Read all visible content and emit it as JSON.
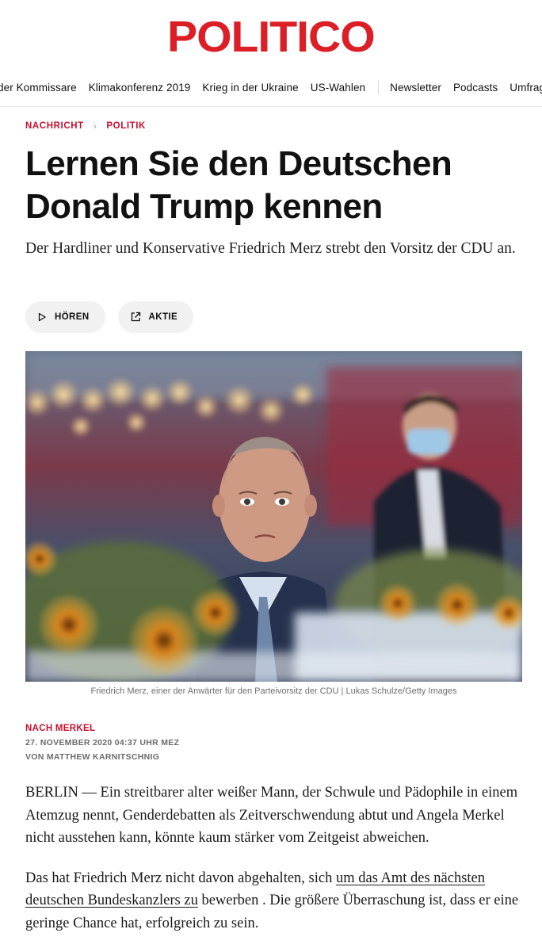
{
  "brand": {
    "logo_text": "POLITICO",
    "color": "#dc1f26"
  },
  "nav": {
    "items": [
      "der Kommissare",
      "Klimakonferenz 2019",
      "Krieg in der Ukraine",
      "US-Wahlen"
    ],
    "secondary": [
      "Newsletter",
      "Podcasts",
      "Umfrage"
    ]
  },
  "breadcrumb": {
    "section": "NACHRICHT",
    "subsection": "POLITIK",
    "chevron": "›"
  },
  "article": {
    "headline": "Lernen Sie den Deutschen Donald Trump kennen",
    "dek": "Der Hardliner und Konservative Friedrich Merz strebt den Vorsitz der CDU an.",
    "actions": {
      "listen": "HÖREN",
      "share": "AKTIE"
    },
    "image_caption": "Friedrich Merz, einer der Anwärter für den Parteivorsitz der CDU | Lukas Schulze/Getty Images",
    "kicker": "NACH MERKEL",
    "date": "27. NOVEMBER 2020 04:37 UHR MEZ",
    "byline": "VON MATTHEW KARNITSCHNIG",
    "p1": "BERLIN — Ein streitbarer alter weißer Mann, der Schwule und Pädophile in einem Atemzug nennt, Genderdebatten als Zeitverschwendung abtut und Angela Merkel nicht ausstehen kann, könnte kaum stärker vom Zeitgeist abweichen.",
    "p2_before": "Das hat Friedrich Merz nicht davon abgehalten, sich ",
    "p2_link": "um das Amt des nächsten deutschen Bundeskanzlers zu",
    "p2_after": " bewerben . Die größere Überraschung ist, dass er eine geringe Chance hat, erfolgreich zu sein."
  },
  "colors": {
    "accent": "#c8102e",
    "pill_bg": "#f1f1f1"
  }
}
